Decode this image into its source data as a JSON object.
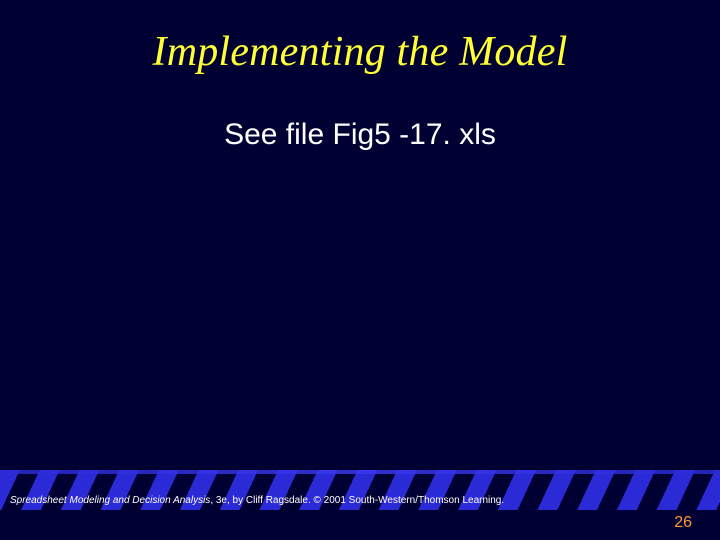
{
  "slide": {
    "title": "Implementing the Model",
    "subtitle": "See file Fig5 -17. xls",
    "citation": {
      "book": "Spreadsheet Modeling and Decision Analysis",
      "rest": ", 3e, by Cliff Ragsdale. © 2001 South-Western/Thomson Learning."
    },
    "page_number": "26"
  }
}
